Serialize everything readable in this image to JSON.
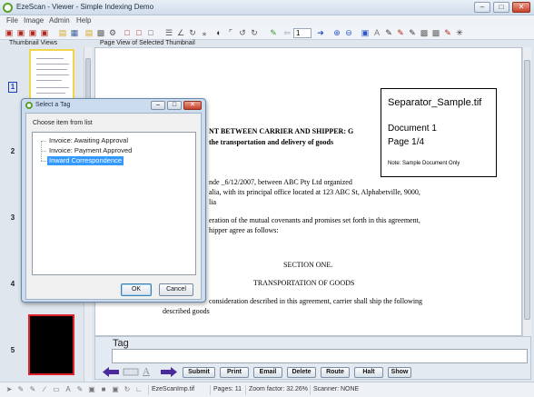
{
  "window": {
    "title": "EzeScan - Viewer - Simple Indexing Demo",
    "minimize_label": "–",
    "maximize_label": "□",
    "close_label": "✕"
  },
  "menu": [
    "File",
    "Image",
    "Admin",
    "Help"
  ],
  "toolbar": {
    "page_number": "1"
  },
  "panels": {
    "thumbnails_header": "Thumbnail Views",
    "pageview_header": "Page View of Selected Thumbnail"
  },
  "thumbnails": [
    {
      "number": "1",
      "selected": true
    },
    {
      "number": "2",
      "selected": false
    },
    {
      "number": "3",
      "selected": false
    },
    {
      "number": "4",
      "selected": false
    },
    {
      "number": "5",
      "selected": false
    }
  ],
  "document": {
    "heading_line1": "NT BETWEEN CARRIER AND SHIPPER:  G",
    "heading_line2": "the transportation and delivery of goods",
    "body_line1": "nde _6/12/2007, between  ABC Pty Ltd  organized",
    "body_line2": "alia, with its principal office located at 123 ABC St, Alphabetville, 9000,",
    "body_line3": "lia",
    "body_line4": "eration of the mutual covenants and promises set forth in this agreement,",
    "body_line5": "hipper agree as follows:",
    "section_title": "SECTION ONE.",
    "section_subtitle": "TRANSPORTATION OF GOODS",
    "body_line6": "consideration described in this agreement, carrier shall ship the following",
    "body_line7": "described goods"
  },
  "separator_box": {
    "filename": "Separator_Sample.tif",
    "document_label": "Document 1",
    "page_label": "Page 1/4",
    "note": "Note: Sample Document Only"
  },
  "tag_panel": {
    "label": "Tag",
    "value": ""
  },
  "actions": [
    "Submit",
    "Print",
    "Email",
    "Delete",
    "Route",
    "Halt",
    "Show"
  ],
  "status": {
    "filename": "EzeScanImp.tif",
    "pages": "Pages: 11",
    "zoom": "Zoom factor: 32.26%",
    "scanner": "Scanner: NONE"
  },
  "dialog": {
    "title": "Select a Tag",
    "prompt": "Choose item from list",
    "items": [
      {
        "label": "Invoice: Awaiting Approval",
        "selected": false
      },
      {
        "label": "Invoice: Payment Approved",
        "selected": false
      },
      {
        "label": "Inward Correspondence",
        "selected": true
      }
    ],
    "ok_label": "OK",
    "cancel_label": "Cancel"
  },
  "colors": {
    "accent_selection": "#3399ff",
    "arrow_purple": "#4a2a9c",
    "thumb_border_red": "#e0202a",
    "thumb_border_yellow": "#f0d64a"
  }
}
